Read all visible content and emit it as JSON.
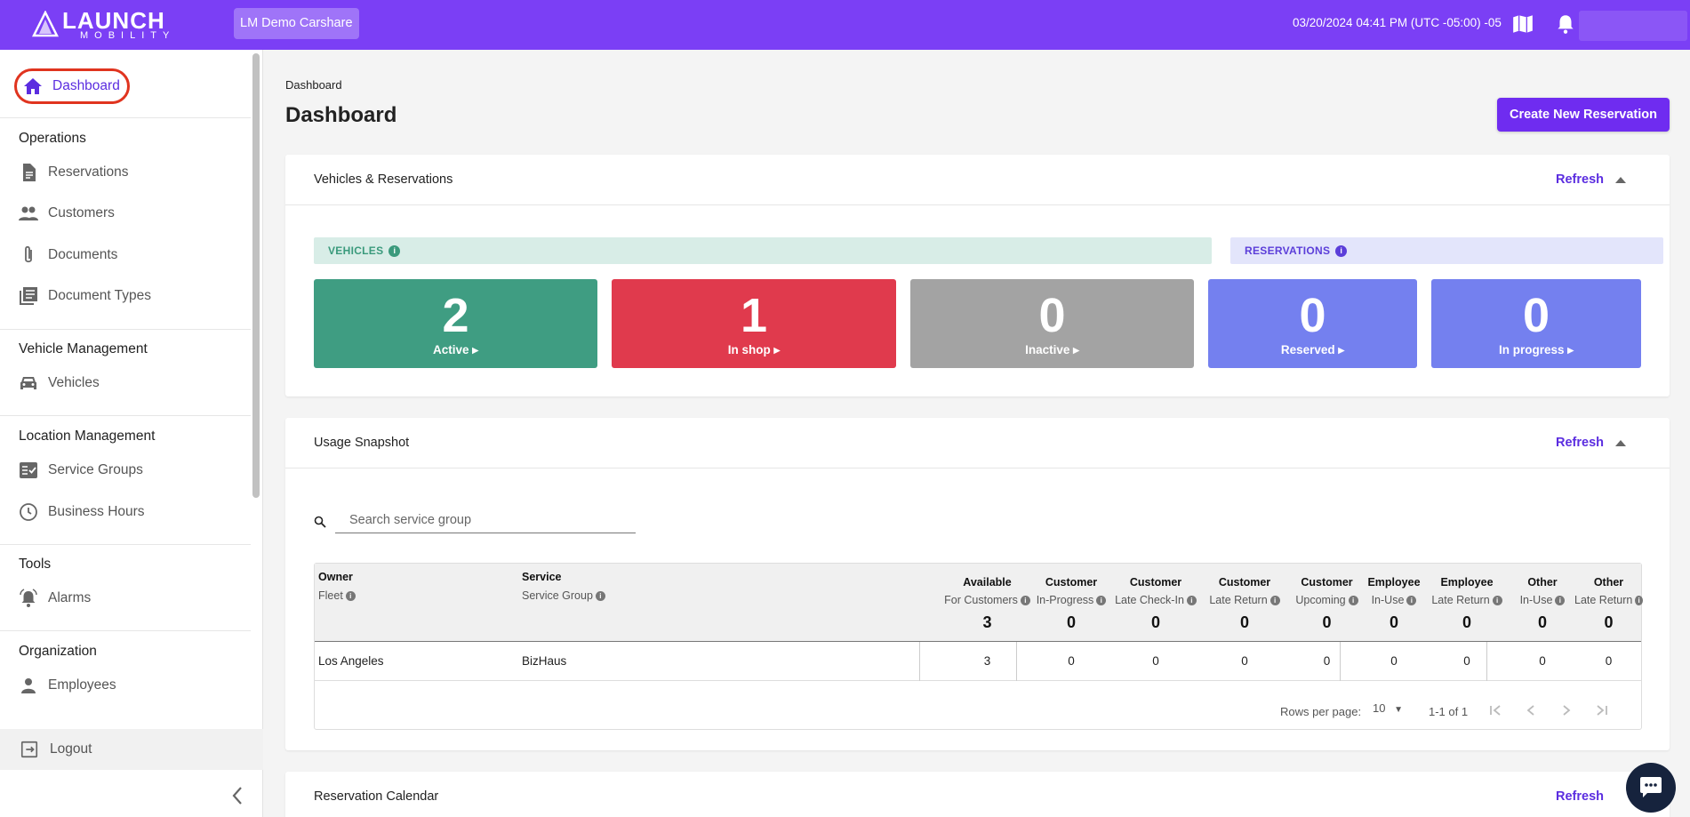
{
  "app": {
    "logo_line1": "LAUNCH",
    "logo_line2": "MOBILITY",
    "org_name": "LM Demo Carshare",
    "datetime": "03/20/2024 04:41 PM (UTC -05:00) -05",
    "brand_color": "#7b3ff5"
  },
  "sidebar": {
    "active_item": "Dashboard",
    "sections": [
      {
        "heading": "Operations",
        "items": [
          "Reservations",
          "Customers",
          "Documents",
          "Document Types"
        ]
      },
      {
        "heading": "Vehicle Management",
        "items": [
          "Vehicles"
        ]
      },
      {
        "heading": "Location Management",
        "items": [
          "Service Groups",
          "Business Hours"
        ]
      },
      {
        "heading": "Tools",
        "items": [
          "Alarms"
        ]
      },
      {
        "heading": "Organization",
        "items": [
          "Employees"
        ]
      }
    ],
    "logout_label": "Logout"
  },
  "page": {
    "breadcrumb": "Dashboard",
    "title": "Dashboard",
    "create_button": "Create New Reservation"
  },
  "vehicles_reservations": {
    "title": "Vehicles & Reservations",
    "refresh_label": "Refresh",
    "vehicles_banner": "VEHICLES",
    "reservations_banner": "RESERVATIONS",
    "tiles": [
      {
        "count": "2",
        "label": "Active",
        "color": "#3f9d82"
      },
      {
        "count": "1",
        "label": "In shop",
        "color": "#e03a4d"
      },
      {
        "count": "0",
        "label": "Inactive",
        "color": "#a3a3a3"
      },
      {
        "count": "0",
        "label": "Reserved",
        "color": "#7480ef"
      },
      {
        "count": "0",
        "label": "In progress",
        "color": "#7480ef"
      }
    ]
  },
  "usage_snapshot": {
    "title": "Usage Snapshot",
    "refresh_label": "Refresh",
    "search_placeholder": "Search service group",
    "columns": {
      "owner": {
        "line1": "Owner",
        "line2": "Fleet"
      },
      "service": {
        "line1": "Service",
        "line2": "Service Group"
      },
      "metrics": [
        {
          "line1": "Available",
          "line2": "For Customers",
          "total": "3"
        },
        {
          "line1": "Customer",
          "line2": "In-Progress",
          "total": "0"
        },
        {
          "line1": "Customer",
          "line2": "Late Check-In",
          "total": "0"
        },
        {
          "line1": "Customer",
          "line2": "Late Return",
          "total": "0"
        },
        {
          "line1": "Customer",
          "line2": "Upcoming",
          "total": "0"
        },
        {
          "line1": "Employee",
          "line2": "In-Use",
          "total": "0"
        },
        {
          "line1": "Employee",
          "line2": "Late Return",
          "total": "0"
        },
        {
          "line1": "Other",
          "line2": "In-Use",
          "total": "0"
        },
        {
          "line1": "Other",
          "line2": "Late Return",
          "total": "0"
        }
      ]
    },
    "rows": [
      {
        "owner": "Los Angeles",
        "service": "BizHaus",
        "values": [
          "3",
          "0",
          "0",
          "0",
          "0",
          "0",
          "0",
          "0",
          "0"
        ]
      }
    ],
    "pagination": {
      "rows_per_page_label": "Rows per page:",
      "rows_per_page": "10",
      "range": "1-1 of 1"
    }
  },
  "reservation_calendar": {
    "title": "Reservation Calendar",
    "refresh_label": "Refresh"
  }
}
